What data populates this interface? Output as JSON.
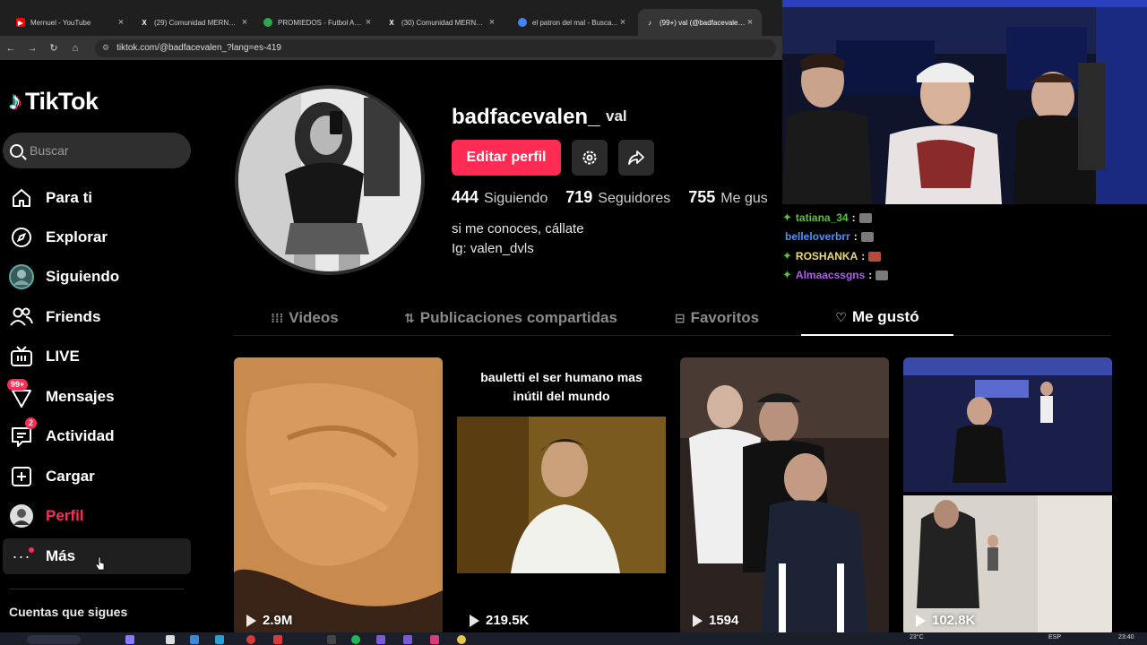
{
  "browser": {
    "tabs": [
      {
        "title": "Mernuel - YouTube",
        "icon": "youtube-icon",
        "color": "#ff0000"
      },
      {
        "title": "(29) Comunidad MERNO...",
        "icon": "x-icon",
        "color": "#ffffff"
      },
      {
        "title": "PROMIEDOS - Futbol Arg...",
        "icon": "promiedos-icon",
        "color": "#2fa84f"
      },
      {
        "title": "(30) Comunidad MERNO...",
        "icon": "x-icon",
        "color": "#ffffff"
      },
      {
        "title": "el patron del mal - Busca...",
        "icon": "google-icon",
        "color": "#4285f4"
      },
      {
        "title": "(99+) val (@badfacevalen...",
        "icon": "tiktok-icon",
        "color": "#ffffff"
      }
    ],
    "url": "tiktok.com/@badfacevalen_?lang=es-419"
  },
  "sidebar": {
    "logo_text": "TikTok",
    "search_placeholder": "Buscar",
    "items": [
      {
        "label": "Para ti",
        "icon": "home-icon"
      },
      {
        "label": "Explorar",
        "icon": "compass-icon"
      },
      {
        "label": "Siguiendo",
        "icon": "following-avatar-icon"
      },
      {
        "label": "Friends",
        "icon": "friends-icon"
      },
      {
        "label": "LIVE",
        "icon": "live-icon"
      },
      {
        "label": "Mensajes",
        "icon": "messages-icon",
        "badge": "99+"
      },
      {
        "label": "Actividad",
        "icon": "activity-icon",
        "badge": "2"
      },
      {
        "label": "Cargar",
        "icon": "upload-icon"
      },
      {
        "label": "Perfil",
        "icon": "profile-avatar-icon"
      },
      {
        "label": "Más",
        "icon": "more-icon"
      }
    ],
    "following_title": "Cuentas que sigues"
  },
  "profile": {
    "username": "badfacevalen_",
    "nickname": "val",
    "edit_button": "Editar perfil",
    "stats": [
      {
        "value": "444",
        "label": "Siguiendo"
      },
      {
        "value": "719",
        "label": "Seguidores"
      },
      {
        "value": "755",
        "label": "Me gus"
      }
    ],
    "bio_line1": "si me conoces, cállate",
    "bio_line2": "Ig: valen_dvls",
    "tabs": [
      {
        "label": "Videos",
        "icon": "grid-icon"
      },
      {
        "label": "Publicaciones compartidas",
        "icon": "repost-icon"
      },
      {
        "label": "Favoritos",
        "icon": "bookmark-icon"
      },
      {
        "label": "Me gustó",
        "icon": "liked-icon"
      }
    ],
    "videos": [
      {
        "views": "2.9M",
        "caption": ""
      },
      {
        "views": "219.5K",
        "caption_line1": "bauletti el ser humano mas",
        "caption_line2": "inútil del mundo"
      },
      {
        "views": "1594",
        "caption": ""
      },
      {
        "views": "102.8K",
        "caption": ""
      }
    ]
  },
  "stream": {
    "chat": [
      {
        "user": "tatiana_34",
        "color": "#59c33a"
      },
      {
        "user": "belleloverbrr",
        "color": "#4f8ff7"
      },
      {
        "user": "ROSHANKA",
        "color": "#f0d97a"
      },
      {
        "user": "Almaacssgns",
        "color": "#b05cf0"
      }
    ]
  },
  "taskbar": {
    "temperature": "23°C",
    "language": "ESP",
    "time": "23:40"
  }
}
